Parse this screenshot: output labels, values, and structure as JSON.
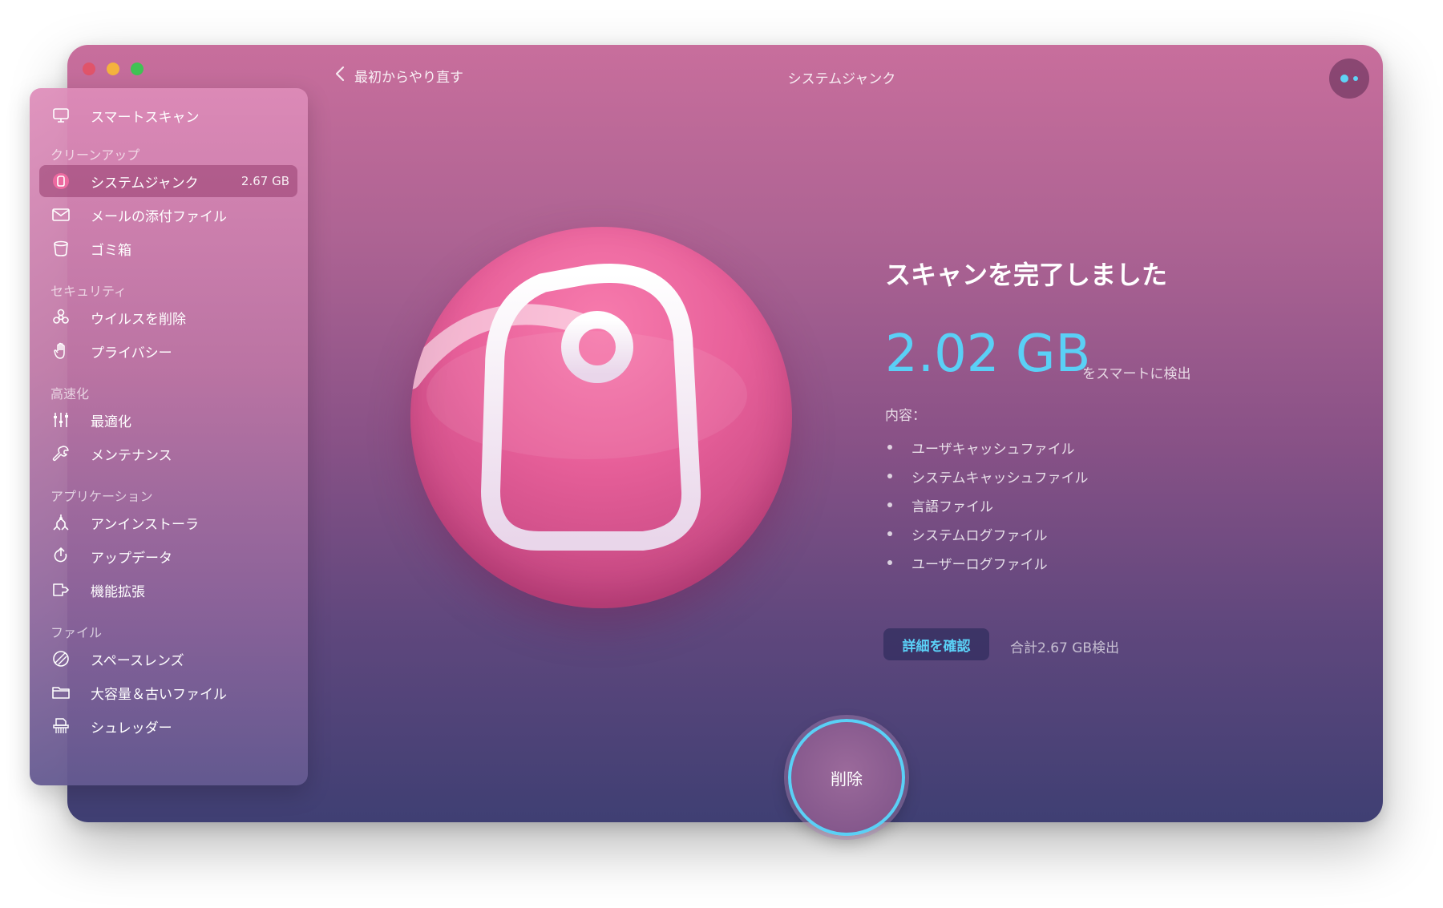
{
  "window": {
    "back_label": "最初からやり直す",
    "title": "システムジャンク"
  },
  "sidebar": {
    "smart_scan": {
      "label": "スマートスキャン",
      "icon": "monitor-icon"
    },
    "sections": [
      {
        "heading": "クリーンアップ",
        "items": [
          {
            "label": "システムジャンク",
            "size": "2.67 GB",
            "icon": "system-junk-icon",
            "active": true
          },
          {
            "label": "メールの添付ファイル",
            "icon": "mail-icon"
          },
          {
            "label": "ゴミ箱",
            "icon": "trash-icon"
          }
        ]
      },
      {
        "heading": "セキュリティ",
        "items": [
          {
            "label": "ウイルスを削除",
            "icon": "biohazard-icon"
          },
          {
            "label": "プライバシー",
            "icon": "hand-icon"
          }
        ]
      },
      {
        "heading": "高速化",
        "items": [
          {
            "label": "最適化",
            "icon": "sliders-icon"
          },
          {
            "label": "メンテナンス",
            "icon": "wrench-icon"
          }
        ]
      },
      {
        "heading": "アプリケーション",
        "items": [
          {
            "label": "アンインストーラ",
            "icon": "uninstaller-icon"
          },
          {
            "label": "アップデータ",
            "icon": "updater-icon"
          },
          {
            "label": "機能拡張",
            "icon": "extensions-icon"
          }
        ]
      },
      {
        "heading": "ファイル",
        "items": [
          {
            "label": "スペースレンズ",
            "icon": "space-lens-icon"
          },
          {
            "label": "大容量＆古いファイル",
            "icon": "folder-icon"
          },
          {
            "label": "シュレッダー",
            "icon": "shredder-icon"
          }
        ]
      }
    ]
  },
  "main": {
    "scan_title": "スキャンを完了しました",
    "amount": "2.02 GB",
    "amount_suffix": "をスマートに検出",
    "contents_label": "内容：",
    "contents": [
      "ユーザキャッシュファイル",
      "システムキャッシュファイル",
      "言語ファイル",
      "システムログファイル",
      "ユーザーログファイル"
    ],
    "details_button": "詳細を確認",
    "total_found": "合計2.67 GB検出",
    "delete_button": "削除"
  },
  "colors": {
    "accent": "#5ad0f6",
    "traffic_red": "#e0546a",
    "traffic_yellow": "#f4b23e",
    "traffic_green": "#40c254"
  }
}
